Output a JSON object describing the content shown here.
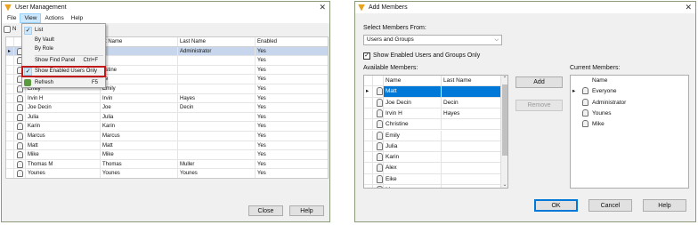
{
  "win1": {
    "title": "User Management",
    "menu": [
      "File",
      "View",
      "Actions",
      "Help"
    ],
    "view_menu": [
      {
        "label": "List",
        "accel": "",
        "checked": true
      },
      {
        "label": "By Vault",
        "accel": "",
        "checked": false
      },
      {
        "label": "By Role",
        "accel": "",
        "checked": false
      },
      {
        "label": "Show Find Panel",
        "accel": "Ctrl+F",
        "checked": false
      },
      {
        "label": "Show Enabled Users Only",
        "accel": "",
        "checked": true
      },
      {
        "label": "Refresh",
        "accel": "F5",
        "checked": false
      }
    ],
    "toolbar_glyph": "N",
    "columns": [
      "",
      "",
      "",
      "st Name",
      "Last Name",
      "Enabled"
    ],
    "rows": [
      {
        "user": "",
        "first": "",
        "last": "Administrator",
        "enabled": "Yes"
      },
      {
        "user": "",
        "first": "y",
        "last": "",
        "enabled": "Yes"
      },
      {
        "user": "",
        "first": "ristine",
        "last": "",
        "enabled": "Yes"
      },
      {
        "user": "",
        "first": "ke",
        "last": "",
        "enabled": "Yes"
      },
      {
        "user": "Emily",
        "first": "Emily",
        "last": "",
        "enabled": "Yes"
      },
      {
        "user": "Irvin H",
        "first": "Irvin",
        "last": "Hayes",
        "enabled": "Yes"
      },
      {
        "user": "Joe Decin",
        "first": "Joe",
        "last": "Decin",
        "enabled": "Yes"
      },
      {
        "user": "Julia",
        "first": "Julia",
        "last": "",
        "enabled": "Yes"
      },
      {
        "user": "Karin",
        "first": "Karin",
        "last": "",
        "enabled": "Yes"
      },
      {
        "user": "Marcus",
        "first": "Marcus",
        "last": "",
        "enabled": "Yes"
      },
      {
        "user": "Matt",
        "first": "Matt",
        "last": "",
        "enabled": "Yes"
      },
      {
        "user": "Mike",
        "first": "Mike",
        "last": "",
        "enabled": "Yes"
      },
      {
        "user": "Thomas M",
        "first": "Thomas",
        "last": "Muller",
        "enabled": "Yes"
      },
      {
        "user": "Younes",
        "first": "Younes",
        "last": "Younes",
        "enabled": "Yes"
      }
    ],
    "buttons": {
      "close": "Close",
      "help": "Help"
    }
  },
  "win2": {
    "title": "Add Members",
    "select_label": "Select Members From:",
    "select_value": "Users and Groups",
    "checkbox_label": "Show Enabled Users and Groups Only",
    "available_label": "Available Members:",
    "current_label": "Current Members:",
    "available_columns": [
      "Name",
      "Last Name"
    ],
    "available": [
      {
        "name": "Matt",
        "last": ""
      },
      {
        "name": "Joe Decin",
        "last": "Decin"
      },
      {
        "name": "Irvin H",
        "last": "Hayes"
      },
      {
        "name": "Christine",
        "last": ""
      },
      {
        "name": "Emily",
        "last": ""
      },
      {
        "name": "Julia",
        "last": ""
      },
      {
        "name": "Karin",
        "last": ""
      },
      {
        "name": "Alex",
        "last": ""
      },
      {
        "name": "Eike",
        "last": ""
      },
      {
        "name": "M...",
        "last": ""
      }
    ],
    "current_columns": [
      "Name"
    ],
    "current": [
      "Everyone",
      "Administrator",
      "Younes",
      "Mike"
    ],
    "buttons": {
      "add": "Add",
      "remove": "Remove",
      "ok": "OK",
      "cancel": "Cancel",
      "help": "Help"
    }
  }
}
